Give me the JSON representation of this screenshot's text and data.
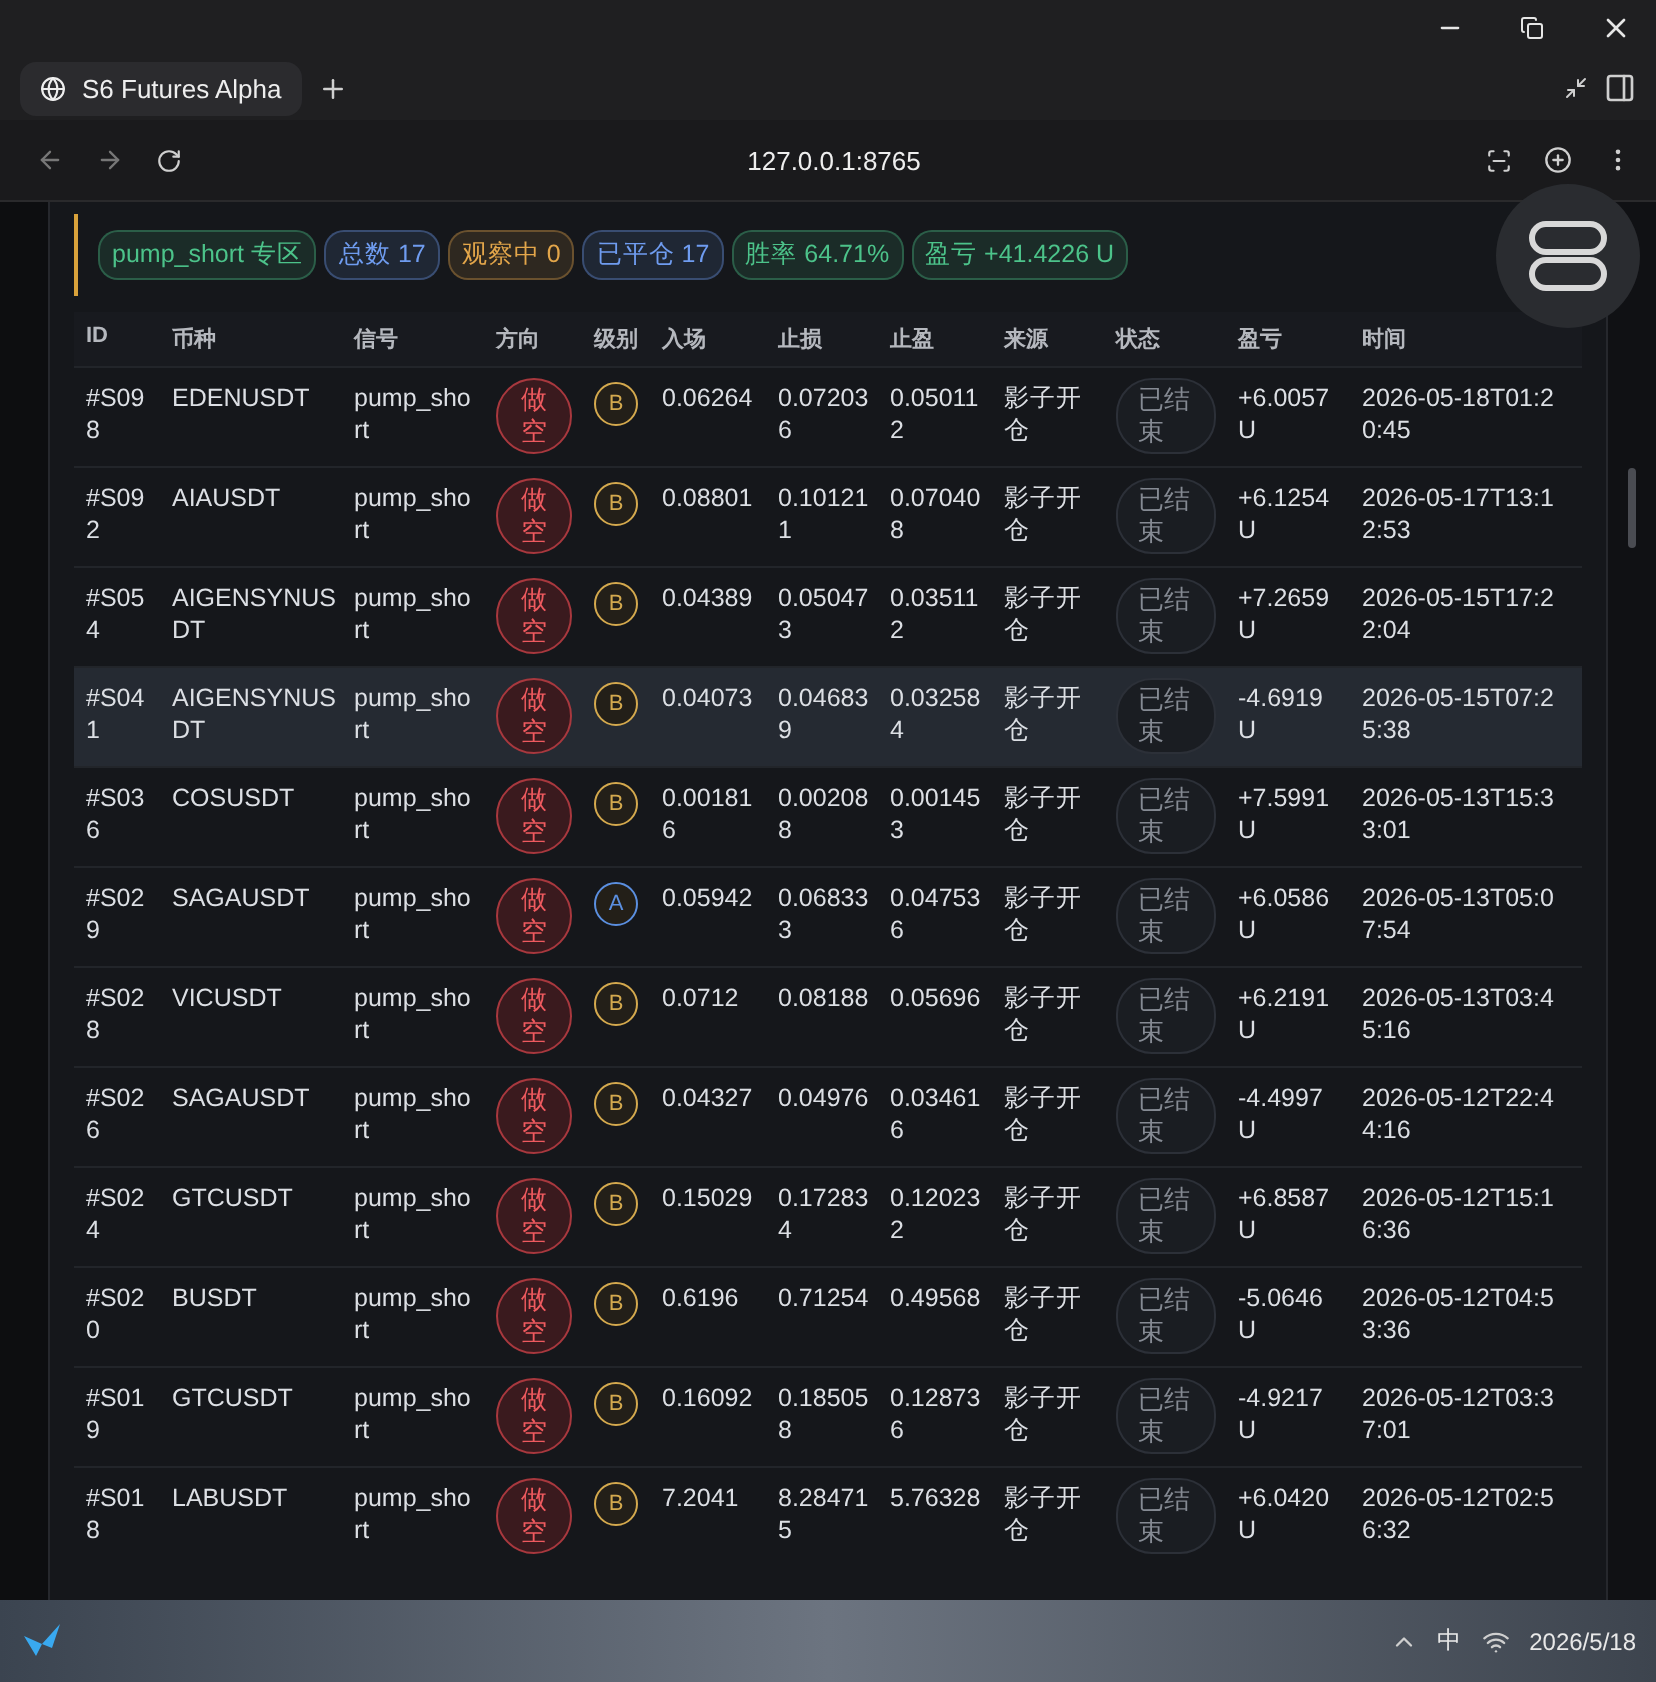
{
  "window": {
    "tab_title": "S6 Futures Alpha",
    "url": "127.0.0.1:8765"
  },
  "chips": [
    {
      "label": "pump_short 专区",
      "color": "#4cc38a"
    },
    {
      "label": "总数 17",
      "color": "#6f9cf0"
    },
    {
      "label": "观察中 0",
      "color": "#e3a64a"
    },
    {
      "label": "已平仓 17",
      "color": "#6f9cf0"
    },
    {
      "label": "胜率 64.71%",
      "color": "#4cc38a"
    },
    {
      "label": "盈亏 +41.4226 U",
      "color": "#4cc38a"
    }
  ],
  "table": {
    "columns": [
      "ID",
      "币种",
      "信号",
      "方向",
      "级别",
      "入场",
      "止损",
      "止盈",
      "来源",
      "状态",
      "盈亏",
      "时间"
    ],
    "rows": [
      {
        "id": "#S098",
        "symbol": "EDENUSDT",
        "signal": "pump_short",
        "direction": "做空",
        "grade": {
          "label": "B",
          "color": "#d4a94e"
        },
        "entry": "0.06264",
        "stop_loss": "0.072036",
        "take_profit": "0.050112",
        "source": "影子开仓",
        "status": "已结束",
        "pnl": "+6.0057 U",
        "time": "2026-05-18T01:20:45",
        "hovered": false
      },
      {
        "id": "#S092",
        "symbol": "AIAUSDT",
        "signal": "pump_short",
        "direction": "做空",
        "grade": {
          "label": "B",
          "color": "#d4a94e"
        },
        "entry": "0.08801",
        "stop_loss": "0.101211",
        "take_profit": "0.070408",
        "source": "影子开仓",
        "status": "已结束",
        "pnl": "+6.1254 U",
        "time": "2026-05-17T13:12:53",
        "hovered": false
      },
      {
        "id": "#S054",
        "symbol": "AIGENSYNUSDT",
        "signal": "pump_short",
        "direction": "做空",
        "grade": {
          "label": "B",
          "color": "#d4a94e"
        },
        "entry": "0.04389",
        "stop_loss": "0.050473",
        "take_profit": "0.035112",
        "source": "影子开仓",
        "status": "已结束",
        "pnl": "+7.2659 U",
        "time": "2026-05-15T17:22:04",
        "hovered": false
      },
      {
        "id": "#S041",
        "symbol": "AIGENSYNUSDT",
        "signal": "pump_short",
        "direction": "做空",
        "grade": {
          "label": "B",
          "color": "#d4a94e"
        },
        "entry": "0.04073",
        "stop_loss": "0.046839",
        "take_profit": "0.032584",
        "source": "影子开仓",
        "status": "已结束",
        "pnl": "-4.6919 U",
        "time": "2026-05-15T07:25:38",
        "hovered": true
      },
      {
        "id": "#S036",
        "symbol": "COSUSDT",
        "signal": "pump_short",
        "direction": "做空",
        "grade": {
          "label": "B",
          "color": "#d4a94e"
        },
        "entry": "0.001816",
        "stop_loss": "0.002088",
        "take_profit": "0.001453",
        "source": "影子开仓",
        "status": "已结束",
        "pnl": "+7.5991 U",
        "time": "2026-05-13T15:33:01",
        "hovered": false
      },
      {
        "id": "#S029",
        "symbol": "SAGAUSDT",
        "signal": "pump_short",
        "direction": "做空",
        "grade": {
          "label": "A",
          "color": "#5b8fe0"
        },
        "entry": "0.05942",
        "stop_loss": "0.068333",
        "take_profit": "0.047536",
        "source": "影子开仓",
        "status": "已结束",
        "pnl": "+6.0586 U",
        "time": "2026-05-13T05:07:54",
        "hovered": false
      },
      {
        "id": "#S028",
        "symbol": "VICUSDT",
        "signal": "pump_short",
        "direction": "做空",
        "grade": {
          "label": "B",
          "color": "#d4a94e"
        },
        "entry": "0.0712",
        "stop_loss": "0.08188",
        "take_profit": "0.05696",
        "source": "影子开仓",
        "status": "已结束",
        "pnl": "+6.2191 U",
        "time": "2026-05-13T03:45:16",
        "hovered": false
      },
      {
        "id": "#S026",
        "symbol": "SAGAUSDT",
        "signal": "pump_short",
        "direction": "做空",
        "grade": {
          "label": "B",
          "color": "#d4a94e"
        },
        "entry": "0.04327",
        "stop_loss": "0.04976",
        "take_profit": "0.034616",
        "source": "影子开仓",
        "status": "已结束",
        "pnl": "-4.4997 U",
        "time": "2026-05-12T22:44:16",
        "hovered": false
      },
      {
        "id": "#S024",
        "symbol": "GTCUSDT",
        "signal": "pump_short",
        "direction": "做空",
        "grade": {
          "label": "B",
          "color": "#d4a94e"
        },
        "entry": "0.15029",
        "stop_loss": "0.172834",
        "take_profit": "0.120232",
        "source": "影子开仓",
        "status": "已结束",
        "pnl": "+6.8587 U",
        "time": "2026-05-12T15:16:36",
        "hovered": false
      },
      {
        "id": "#S020",
        "symbol": "BUSDT",
        "signal": "pump_short",
        "direction": "做空",
        "grade": {
          "label": "B",
          "color": "#d4a94e"
        },
        "entry": "0.6196",
        "stop_loss": "0.71254",
        "take_profit": "0.49568",
        "source": "影子开仓",
        "status": "已结束",
        "pnl": "-5.0646 U",
        "time": "2026-05-12T04:53:36",
        "hovered": false
      },
      {
        "id": "#S019",
        "symbol": "GTCUSDT",
        "signal": "pump_short",
        "direction": "做空",
        "grade": {
          "label": "B",
          "color": "#d4a94e"
        },
        "entry": "0.16092",
        "stop_loss": "0.185058",
        "take_profit": "0.128736",
        "source": "影子开仓",
        "status": "已结束",
        "pnl": "-4.9217 U",
        "time": "2026-05-12T03:37:01",
        "hovered": false
      },
      {
        "id": "#S018",
        "symbol": "LABUSDT",
        "signal": "pump_short",
        "direction": "做空",
        "grade": {
          "label": "B",
          "color": "#d4a94e"
        },
        "entry": "7.2041",
        "stop_loss": "8.284715",
        "take_profit": "5.76328",
        "source": "影子开仓",
        "status": "已结束",
        "pnl": "+6.0420 U",
        "time": "2026-05-12T02:56:32",
        "hovered": false
      }
    ]
  },
  "taskbar": {
    "ime": "中",
    "date": "2026/5/18"
  }
}
